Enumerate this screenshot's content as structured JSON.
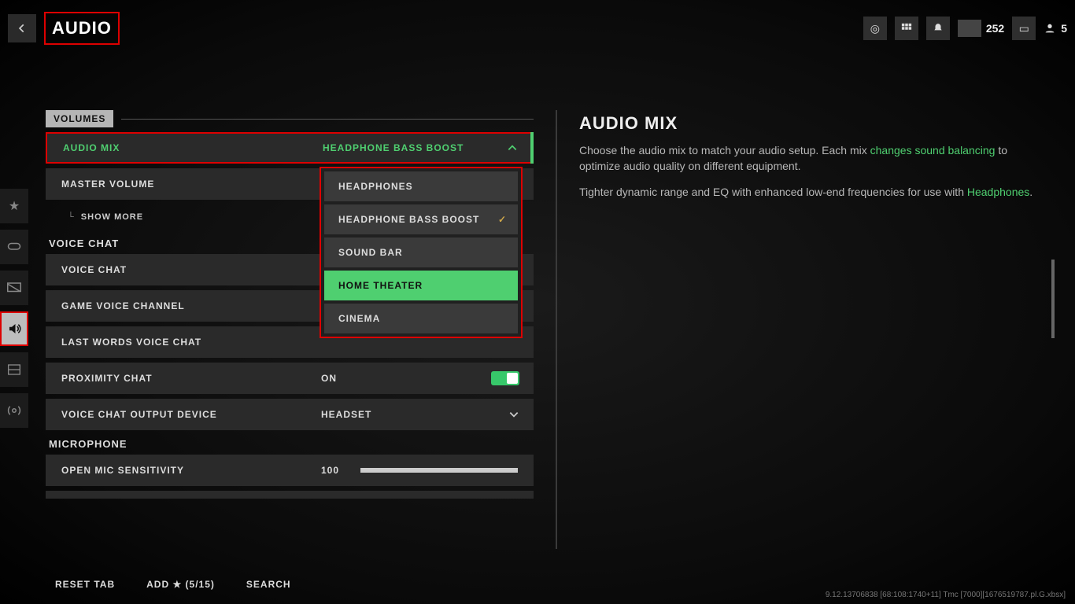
{
  "header": {
    "title": "AUDIO",
    "currency_count": "252",
    "party_count": "5"
  },
  "sections": {
    "volumes": "VOLUMES",
    "voice_chat": "VOICE CHAT",
    "microphone": "MICROPHONE"
  },
  "rows": {
    "audio_mix": {
      "label": "AUDIO MIX",
      "value": "HEADPHONE BASS BOOST"
    },
    "master_volume": {
      "label": "MASTER VOLUME"
    },
    "show_more": "SHOW MORE",
    "voice_chat": {
      "label": "VOICE CHAT"
    },
    "game_voice_channel": {
      "label": "GAME VOICE CHANNEL"
    },
    "last_words_voice_chat": {
      "label": "LAST WORDS VOICE CHAT"
    },
    "proximity_chat": {
      "label": "PROXIMITY CHAT",
      "value": "ON"
    },
    "voice_chat_output_device": {
      "label": "VOICE CHAT OUTPUT DEVICE",
      "value": "HEADSET"
    },
    "open_mic_sensitivity": {
      "label": "OPEN MIC SENSITIVITY",
      "value": "100"
    }
  },
  "dropdown": {
    "options": [
      {
        "label": "HEADPHONES"
      },
      {
        "label": "HEADPHONE BASS BOOST",
        "checked": true
      },
      {
        "label": "SOUND BAR"
      },
      {
        "label": "HOME THEATER",
        "hover": true
      },
      {
        "label": "CINEMA"
      }
    ]
  },
  "right_panel": {
    "title": "AUDIO MIX",
    "p1_a": "Choose the audio mix to match your audio setup. Each mix ",
    "p1_link": "changes sound balancing",
    "p1_b": " to optimize audio quality on different equipment.",
    "p2_a": "Tighter dynamic range and EQ with enhanced low-end frequencies for use with ",
    "p2_link": "Headphones",
    "p2_b": "."
  },
  "footer": {
    "reset": "RESET TAB",
    "add": "ADD ★ (5/15)",
    "search": "SEARCH"
  },
  "version": "9.12.13706838 [68:108:1740+11] Tmc [7000][1676519787.pl.G.xbsx]"
}
